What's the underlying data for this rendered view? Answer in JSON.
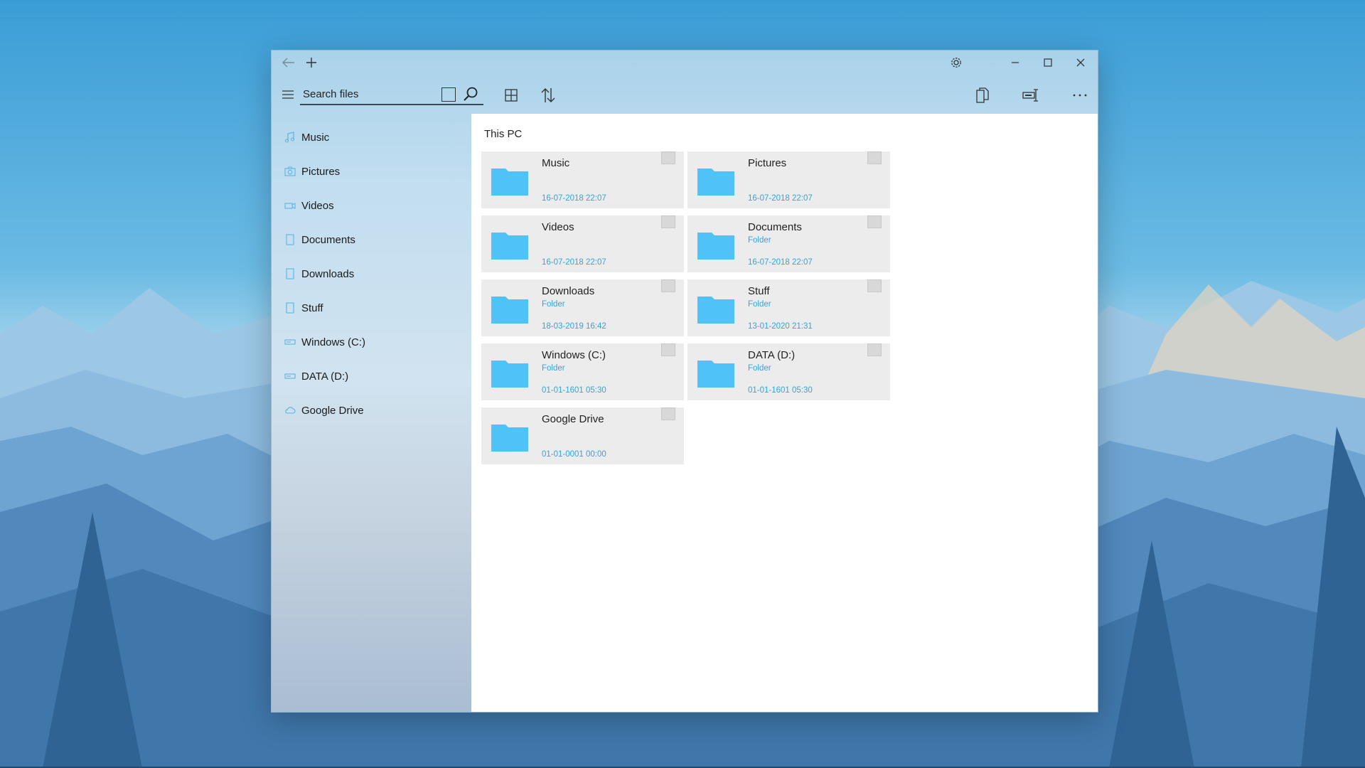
{
  "search": {
    "placeholder": "Search files"
  },
  "sidebar": {
    "items": [
      {
        "label": "Music",
        "icon": "music-icon"
      },
      {
        "label": "Pictures",
        "icon": "camera-icon"
      },
      {
        "label": "Videos",
        "icon": "video-icon"
      },
      {
        "label": "Documents",
        "icon": "document-icon"
      },
      {
        "label": "Downloads",
        "icon": "document-icon"
      },
      {
        "label": "Stuff",
        "icon": "document-icon"
      },
      {
        "label": "Windows (C:)",
        "icon": "drive-icon"
      },
      {
        "label": "DATA (D:)",
        "icon": "drive-icon"
      },
      {
        "label": "Google Drive",
        "icon": "cloud-icon"
      }
    ]
  },
  "main": {
    "title": "This PC",
    "tiles": [
      {
        "name": "Music",
        "type": "",
        "date": "16-07-2018 22:07"
      },
      {
        "name": "Pictures",
        "type": "",
        "date": "16-07-2018 22:07"
      },
      {
        "name": "Videos",
        "type": "",
        "date": "16-07-2018 22:07"
      },
      {
        "name": "Documents",
        "type": "Folder",
        "date": "16-07-2018 22:07"
      },
      {
        "name": "Downloads",
        "type": "Folder",
        "date": "18-03-2019 16:42"
      },
      {
        "name": "Stuff",
        "type": "Folder",
        "date": "13-01-2020 21:31"
      },
      {
        "name": "Windows (C:)",
        "type": "Folder",
        "date": "01-01-1601 05:30"
      },
      {
        "name": "DATA (D:)",
        "type": "Folder",
        "date": "01-01-1601 05:30"
      },
      {
        "name": "Google Drive",
        "type": "",
        "date": "01-01-0001 00:00"
      }
    ]
  },
  "colors": {
    "accent": "#2aa8e0",
    "folder": "#4fc3f7",
    "tile_bg": "#ececec"
  }
}
